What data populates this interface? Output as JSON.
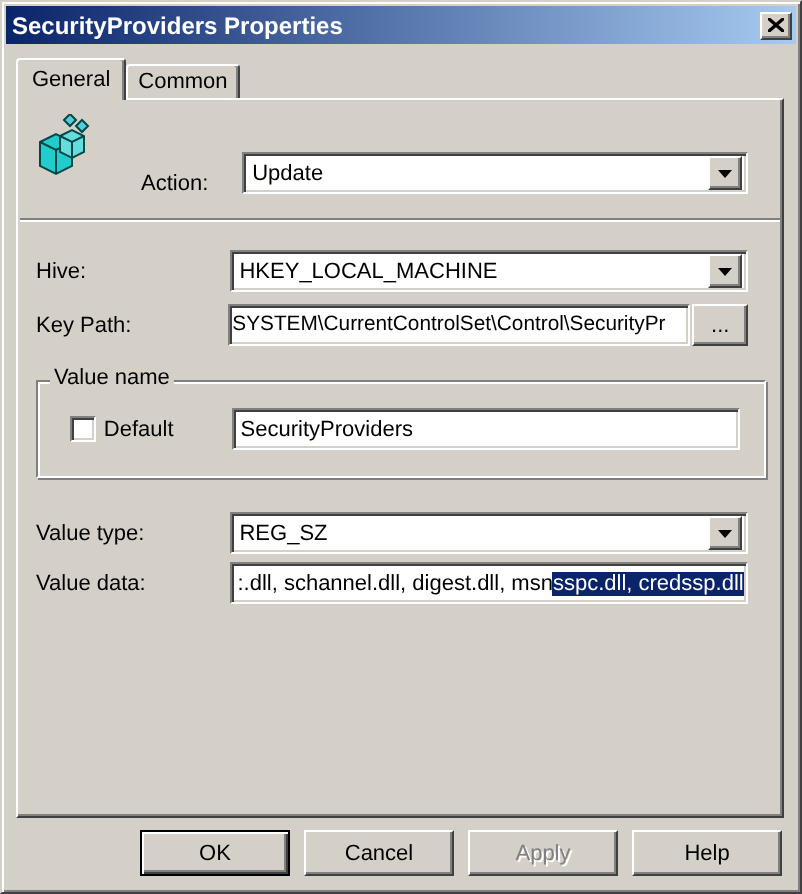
{
  "window": {
    "title": "SecurityProviders Properties"
  },
  "tabs": [
    {
      "label": "General",
      "selected": true
    },
    {
      "label": "Common",
      "selected": false
    }
  ],
  "action": {
    "label": "Action:",
    "value": "Update"
  },
  "hive": {
    "label": "Hive:",
    "value": "HKEY_LOCAL_MACHINE"
  },
  "key_path": {
    "label": "Key Path:",
    "value": "SYSTEM\\CurrentControlSet\\Control\\SecurityPr",
    "browse_button": "..."
  },
  "value_name": {
    "group_title": "Value name",
    "default_checkbox": {
      "label": "Default",
      "checked": false
    },
    "value": "SecurityProviders"
  },
  "value_type": {
    "label": "Value type:",
    "value": "REG_SZ"
  },
  "value_data": {
    "label": "Value data:",
    "value": ":.dll, schannel.dll, digest.dll, msn",
    "selected_text": "sspc.dll, credssp.dll"
  },
  "buttons": [
    {
      "label": "OK",
      "default": true,
      "disabled": false
    },
    {
      "label": "Cancel",
      "default": false,
      "disabled": false
    },
    {
      "label": "Apply",
      "default": false,
      "disabled": true
    },
    {
      "label": "Help",
      "default": false,
      "disabled": false
    }
  ]
}
